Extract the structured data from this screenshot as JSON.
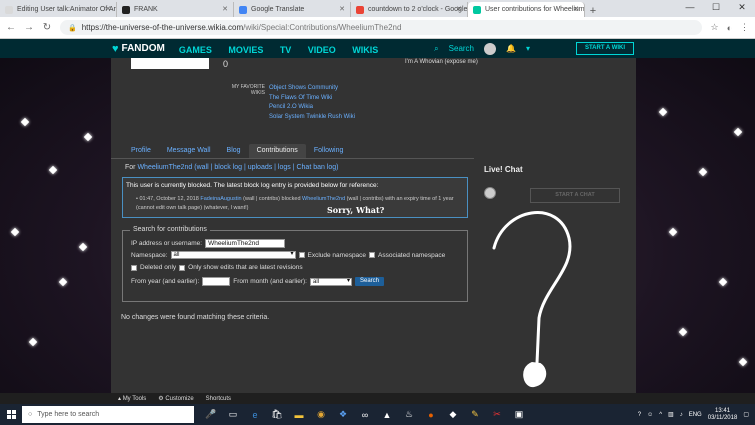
{
  "browser": {
    "tabs": [
      {
        "label": "Editing User talk:Animator Of Ar",
        "color": "#d9d9d9"
      },
      {
        "label": "FRANK",
        "color": "#222222"
      },
      {
        "label": "Google Translate",
        "color": "#4285f4"
      },
      {
        "label": "countdown to 2 o'clock - Google",
        "color": "#ea4335"
      },
      {
        "label": "User contributions for Wheelium",
        "color": "#00c8a0"
      }
    ],
    "url_domain": "https://the-universe-of-the-universe.wikia.com",
    "url_path": "/wiki/Special:Contributions/WheeliumThe2nd"
  },
  "fandom": {
    "logo": "FANDOM",
    "nav": [
      "GAMES",
      "MOVIES",
      "TV",
      "VIDEO",
      "WIKIS"
    ],
    "search_label": "Search",
    "start_wiki": "START A WIKI"
  },
  "profile": {
    "edit_count": "0",
    "i_am": "I'm A Whovian (expose me)",
    "favorite_wikis_label": "MY FAVORITE WIKIS",
    "favorite_wikis": [
      "Object Shows Community",
      "The Flaws Of Time Wiki",
      "Pencil 2.O Wikia",
      "Solar System Twinkle Rush Wiki"
    ],
    "tabs": [
      "Profile",
      "Message Wall",
      "Blog",
      "Contributions",
      "Following"
    ]
  },
  "contribs": {
    "for_prefix": "For ",
    "for_user": "WheeliumThe2nd",
    "for_links": " (wall | block log | uploads | logs | Chat ban log)",
    "block_notice": "This user is currently blocked. The latest block log entry is provided below for reference:",
    "block_entry_time": "01:47, October 12, 2018 ",
    "block_entry_admin": "FadeinaAugustin",
    "block_entry_admin_links": " (wall | contribs) blocked ",
    "block_entry_target": "WheeliumThe2nd",
    "block_entry_target_links": " (wall | contribs)",
    "block_entry_rest": " with an expiry time of 1 year (cannot edit own talk page) (whatever, I want!)",
    "annotation": "Sorry, What?",
    "search_legend": "Search for contributions",
    "ip_label": "IP address or username:",
    "ip_value": "WheeliumThe2nd",
    "namespace_label": "Namespace:",
    "namespace_value": "all",
    "exclude_namespace": "Exclude namespace",
    "associated_namespace": "Associated namespace",
    "deleted_only": "Deleted only",
    "latest_only": "Only show edits that are latest revisions",
    "from_year_label": "From year (and earlier):",
    "from_month_label": "From month (and earlier):",
    "from_month_value": "all",
    "search_button": "Search",
    "no_changes": "No changes were found matching these criteria."
  },
  "rail": {
    "live_chat": "Live! Chat",
    "start_chat": "START A CHAT"
  },
  "toolbar": {
    "my_tools": "My Tools",
    "customize": "Customize",
    "shortcuts": "Shortcuts"
  },
  "taskbar": {
    "search_placeholder": "Type here to search",
    "lang": "ENG",
    "time": "13:41",
    "date": "03/11/2018"
  }
}
